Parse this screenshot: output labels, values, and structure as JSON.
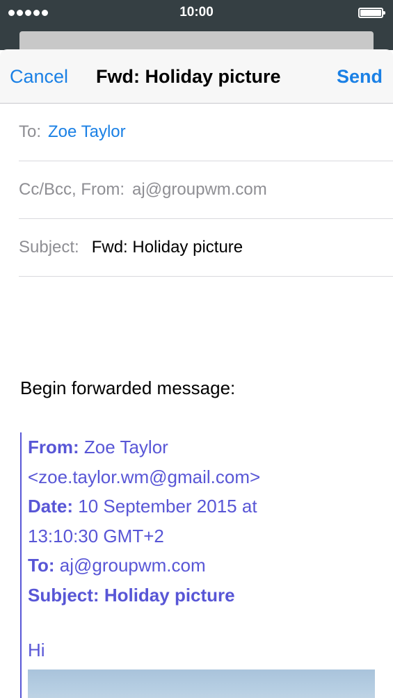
{
  "status_bar": {
    "time": "10:00",
    "signal_icon": "signal-dots-icon",
    "battery_icon": "battery-full-icon"
  },
  "nav": {
    "cancel_label": "Cancel",
    "title": "Fwd: Holiday picture",
    "send_label": "Send"
  },
  "fields": {
    "to_label": "To:",
    "to_value": "Zoe Taylor",
    "cc_label": "Cc/Bcc, From:",
    "cc_value": "aj@groupwm.com",
    "subject_label": "Subject:",
    "subject_value": "Fwd: Holiday picture"
  },
  "body": {
    "intro": "Begin forwarded message:",
    "forwarded": {
      "from_label": "From:",
      "from_value": "Zoe Taylor",
      "from_email": "<zoe.taylor.wm@gmail.com>",
      "date_label": "Date:",
      "date_value": "10 September 2015 at",
      "date_time": "13:10:30 GMT+2",
      "to_label": "To:",
      "to_value": "aj@groupwm.com",
      "subject_label": "Subject:",
      "subject_value": "Holiday picture",
      "greeting": "Hi"
    }
  },
  "colors": {
    "accent": "#1a80e5",
    "quote": "#5856d6",
    "status_bar_bg": "#353f43"
  }
}
